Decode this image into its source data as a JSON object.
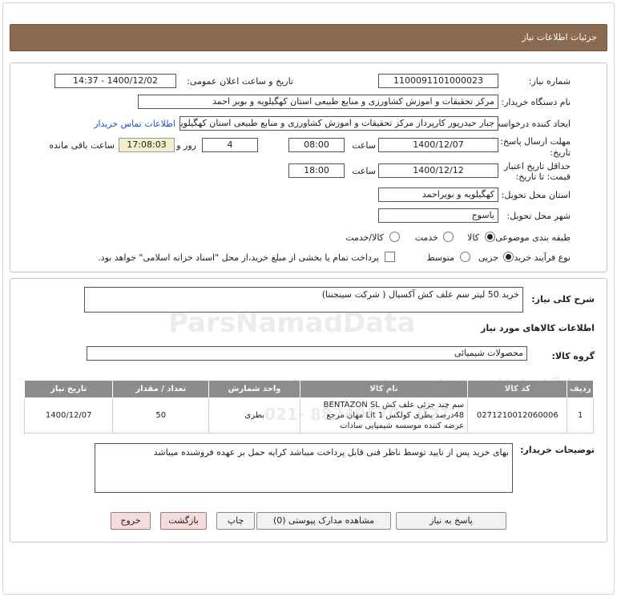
{
  "header": {
    "title": "جزئیات اطلاعات نیاز"
  },
  "form": {
    "need_number_label": "شماره نیاز:",
    "need_number": "1100091101000023",
    "announce_label": "تاریخ و ساعت اعلان عمومی:",
    "announce_value": "1400/12/02 - 14:37",
    "buyer_org_label": "نام دستگاه خریدار:",
    "buyer_org": "مرکز تحقیقات و اموزش کشاورزی و منابع طبیعی استان کهگیلویه و بویر احمد",
    "creator_label": "ایجاد کننده درخواست:",
    "creator": "جبار حیدرپور کارپرداز مرکز تحقیقات و اموزش کشاورزی و منابع طبیعی استان کهگیلویه",
    "contact_link": "اطلاعات تماس خریدار",
    "deadline_label_1": "مهلت ارسال پاسخ: تا",
    "deadline_label_2": "تاریخ:",
    "deadline_date": "1400/12/07",
    "hour_label": "ساعت",
    "deadline_time": "08:00",
    "days": "4",
    "days_label": "روز و",
    "remaining_time": "17:08:03",
    "remaining_label": "ساعت باقی مانده",
    "validity_label_1": "حداقل تاریخ اعتبار",
    "validity_label_2": "قیمت: تا تاریخ:",
    "validity_date": "1400/12/12",
    "validity_hour_label": "ساعت",
    "validity_time": "18:00",
    "province_label": "استان محل تحویل:",
    "province": "کهگیلویه و بویراحمد",
    "city_label": "شهر محل تحویل:",
    "city": "یاسوج",
    "category_label": "طبقه بندی موضوعی:",
    "category_options": [
      "کالا",
      "خدمت",
      "کالا/خدمت"
    ],
    "purchase_label": "نوع فرآیند خرید :",
    "purchase_options": [
      "جزیی",
      "متوسط"
    ],
    "treasury_note": "پرداخت تمام یا بخشی از مبلغ خرید،از محل \"اسناد خزانه اسلامی\" خواهد بود."
  },
  "details": {
    "summary_label": "شرح کلی نیاز:",
    "summary": "خرید 50 لیتر سم علف کش آکسیال ( شرکت سینجنتا)",
    "goods_info_title": "اطلاعات کالاهای مورد نیاز",
    "group_label": "گروه کالا:",
    "group": "محصولات شیمیائی",
    "table_headers": [
      "ردیف",
      "کد کالا",
      "نام کالا",
      "واحد شمارش",
      "تعداد / مقدار",
      "تاریخ نیاز"
    ],
    "rows": [
      {
        "index": "1",
        "code": "0271210012060006",
        "name": "سم چند جزئی علف کش BENTAZON SL 48درصد بطری کولکس Lit 1 مهان مرجع عرضه کننده موسسه شیمیایی سادات",
        "unit": "بطری",
        "qty": "50",
        "date": "1400/12/07"
      }
    ],
    "buyer_notes_label": "توضیحات خریدار:",
    "buyer_notes": "بهای خرید پس از تایید توسط ناظر فنی قابل پرداخت میباشد کرایه حمل بر عهده فروشنده میباشد"
  },
  "buttons": {
    "reply": "پاسخ به نیاز",
    "attachments": "مشاهده مدارک پیوستی (0)",
    "print": "چاپ",
    "back": "بازگشت",
    "exit": "خروج"
  },
  "watermark": {
    "brand": "ParsNamadData",
    "line1": "پایگاه اطلاع رسانی مناقصه و مزایده",
    "phone": "021- 88349670 - 021"
  }
}
